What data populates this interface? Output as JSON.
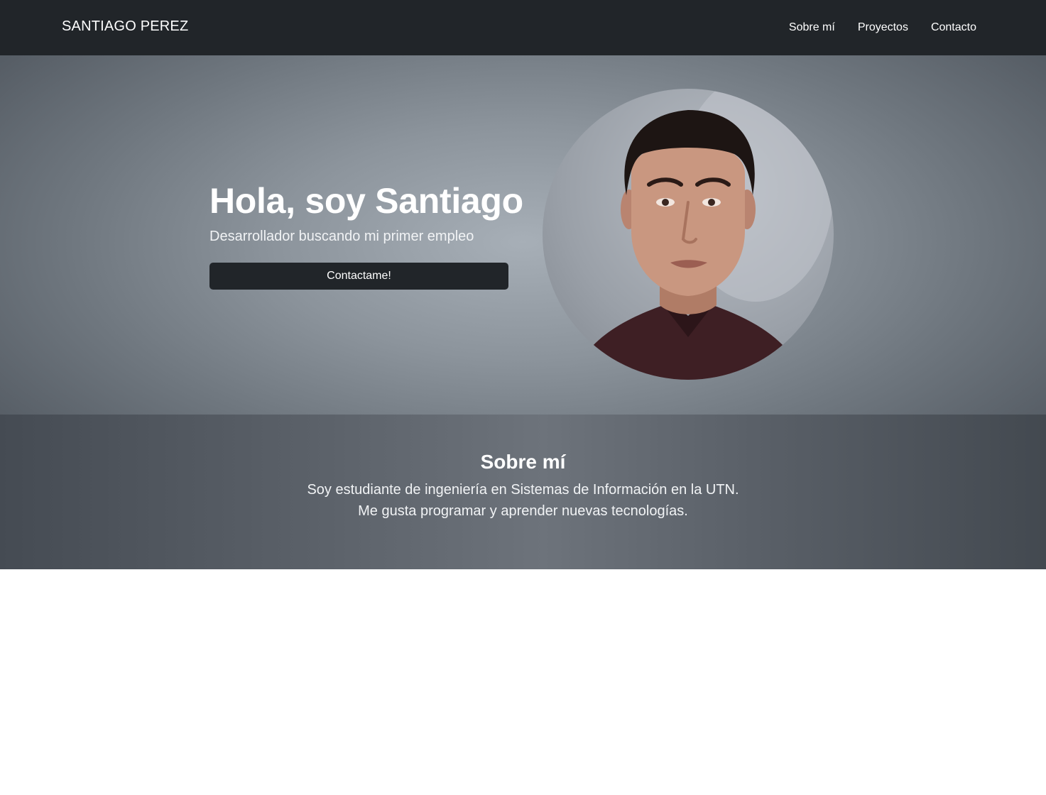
{
  "navbar": {
    "brand": "SANTIAGO PEREZ",
    "links": [
      {
        "label": "Sobre mí"
      },
      {
        "label": "Proyectos"
      },
      {
        "label": "Contacto"
      }
    ]
  },
  "hero": {
    "title": "Hola, soy Santiago",
    "subtitle": "Desarrollador buscando mi primer empleo",
    "cta_label": "Contactame!",
    "photo_alt": "profile photo"
  },
  "about": {
    "title": "Sobre mí",
    "lines": [
      "Soy estudiante de ingeniería en Sistemas de Información en la UTN.",
      "Me gusta programar y aprender nuevas tecnologías."
    ]
  },
  "colors": {
    "navbar_bg": "#212529",
    "button_bg": "#212529",
    "text": "#ffffff"
  }
}
